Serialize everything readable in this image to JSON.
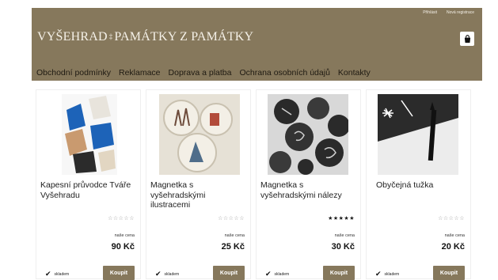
{
  "header": {
    "brand_left": "VYŠEHRAD",
    "brand_sep": "‡",
    "brand_right": "PAMÁTKY Z PAMÁTKY",
    "login": "Přihlásit",
    "register": "Nová registrace",
    "cart_icon": "shopping-bag-icon"
  },
  "nav": [
    {
      "label": "Obchodní podmínky"
    },
    {
      "label": "Reklamace"
    },
    {
      "label": "Doprava a platba"
    },
    {
      "label": "Ochrana osobních údajů"
    },
    {
      "label": "Kontakty"
    }
  ],
  "products": [
    {
      "name": "Kapesní průvodce Tváře Vyšehradu",
      "rating": 0,
      "price_label": "naše cena",
      "price": "90 Kč",
      "stock": "skladem",
      "buy_label": "Koupit"
    },
    {
      "name": "Magnetka s vyšehradskými ilustracemi",
      "rating": 0,
      "price_label": "naše cena",
      "price": "25 Kč",
      "stock": "skladem",
      "buy_label": "Koupit"
    },
    {
      "name": "Magnetka s vyšehradskými nálezy",
      "rating": 4.5,
      "price_label": "naše cena",
      "price": "30 Kč",
      "stock": "skladem",
      "buy_label": "Koupit"
    },
    {
      "name": "Obyčejná tužka",
      "rating": 0,
      "price_label": "naše cena",
      "price": "20 Kč",
      "stock": "skladem",
      "buy_label": "Koupit"
    }
  ],
  "colors": {
    "accent": "#86785c",
    "nav_text": "#1f1a12",
    "background": "#ffffff"
  }
}
